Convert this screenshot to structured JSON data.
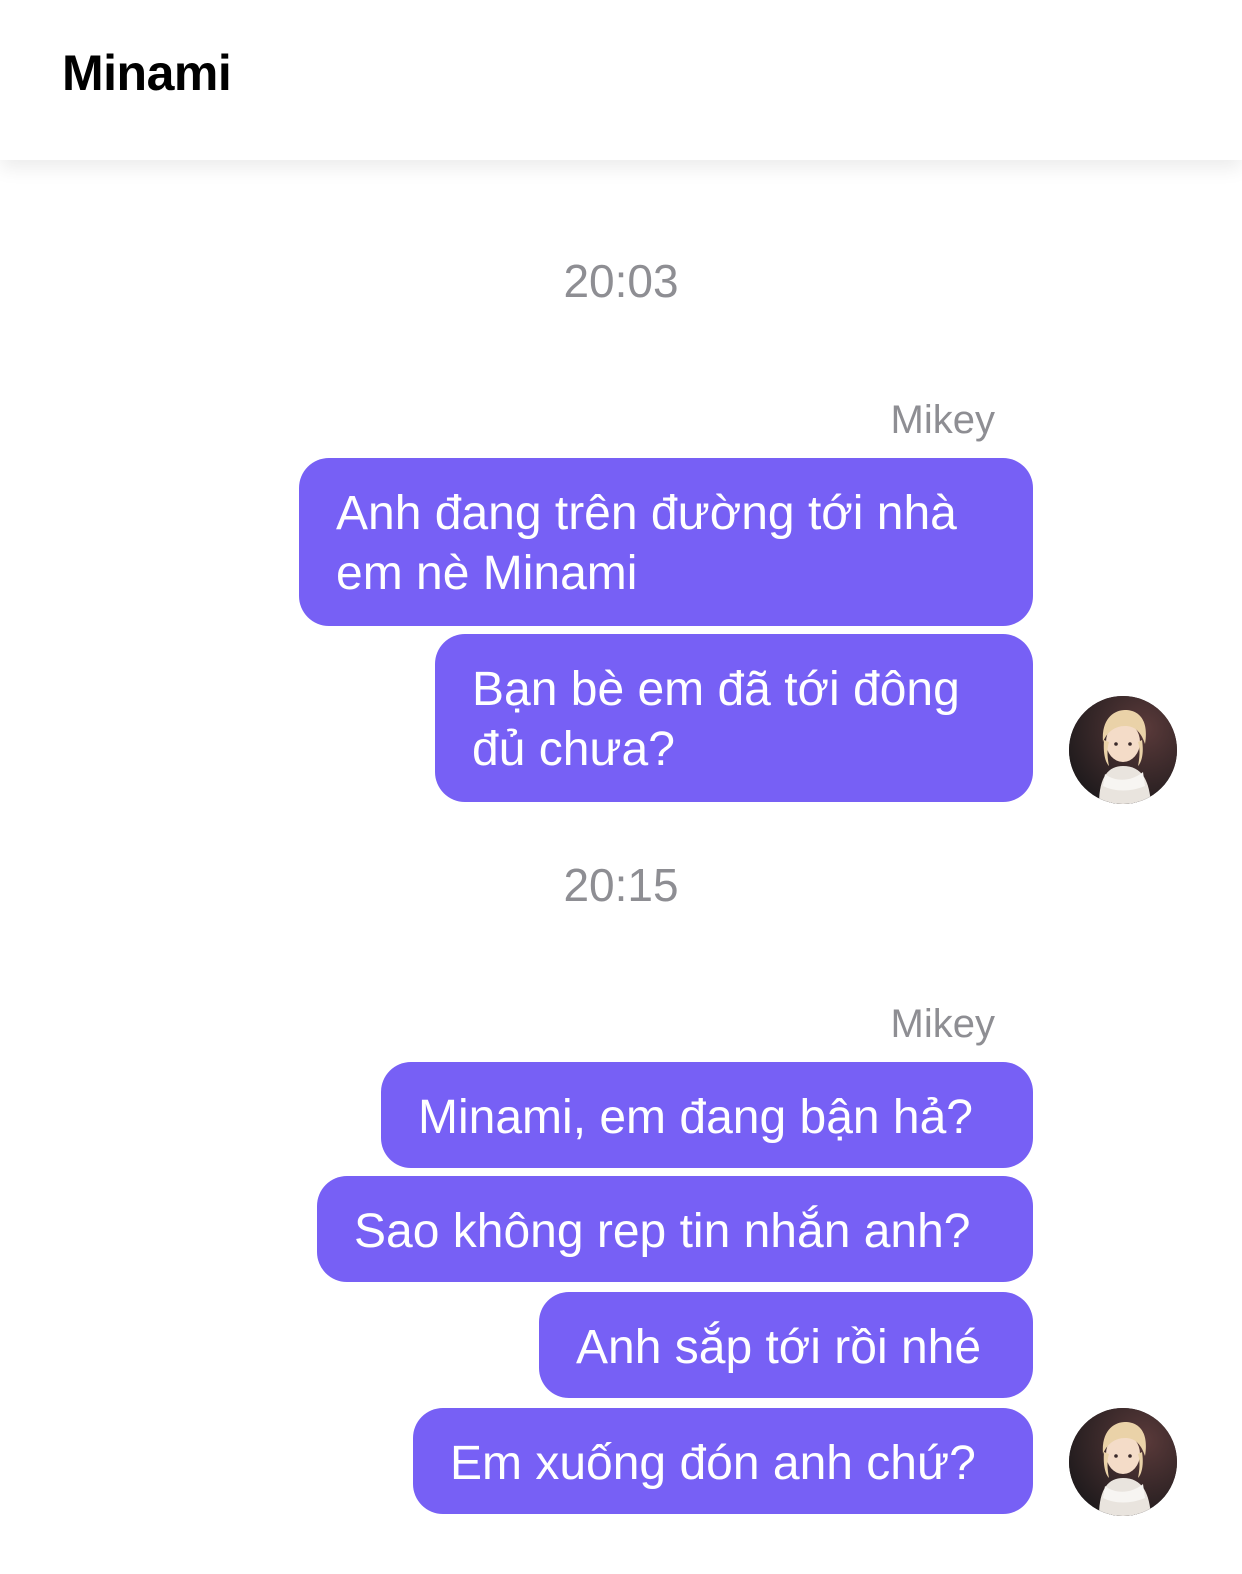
{
  "header": {
    "title": "Minami"
  },
  "groups": [
    {
      "timestamp": "20:03",
      "sender": "Mikey",
      "messages": [
        "Anh đang trên đường tới nhà em nè Minami",
        "Bạn bè em đã tới đông đủ chưa?"
      ]
    },
    {
      "timestamp": "20:15",
      "sender": "Mikey",
      "messages": [
        "Minami, em đang bận hả?",
        "Sao không rep tin nhắn anh?",
        "Anh sắp tới rồi nhé",
        "Em xuống đón anh chứ?"
      ]
    }
  ],
  "colors": {
    "bubble": "#7760f5",
    "bubble_text": "#ffffff",
    "meta_text": "#8e8e93"
  },
  "icons": {
    "avatar": "avatar-icon"
  }
}
